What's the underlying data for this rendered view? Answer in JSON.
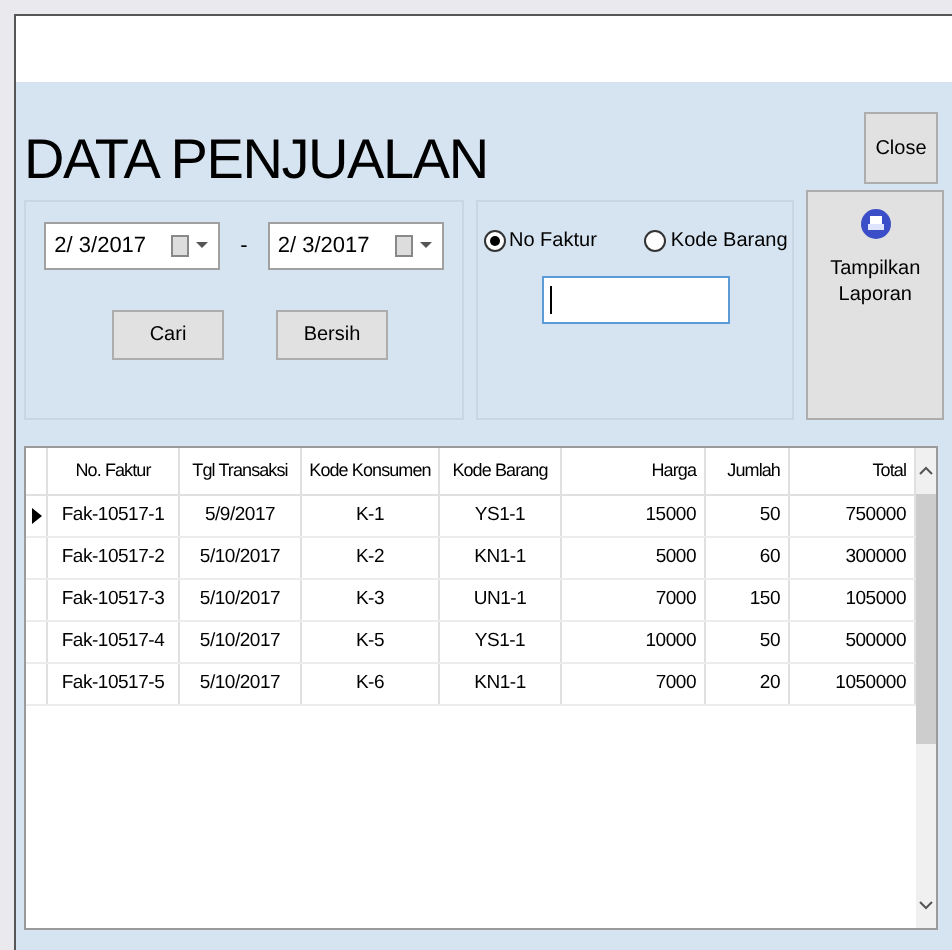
{
  "title": "DATA PENJUALAN",
  "close_button": "Close",
  "date_range": {
    "from": "2/ 3/2017",
    "separator": "-",
    "to": "2/ 3/2017"
  },
  "filter_buttons": [
    "Cari",
    "Bersih"
  ],
  "search_by": [
    {
      "label": "No Faktur",
      "selected": true
    },
    {
      "label": "Kode Barang",
      "selected": false
    }
  ],
  "report_button": {
    "line1": "Tampilkan",
    "line2": "Laporan"
  },
  "table": {
    "columns": [
      "No. Faktur",
      "Tgl Transaksi",
      "Kode Konsumen",
      "Kode Barang",
      "Harga",
      "Jumlah",
      "Total"
    ],
    "rows": [
      {
        "selected": true,
        "cells": [
          "Fak-10517-1",
          "5/9/2017",
          "K-1",
          "YS1-1",
          "15000",
          "50",
          "750000"
        ]
      },
      {
        "selected": false,
        "cells": [
          "Fak-10517-2",
          "5/10/2017",
          "K-2",
          "KN1-1",
          "5000",
          "60",
          "300000"
        ]
      },
      {
        "selected": false,
        "cells": [
          "Fak-10517-3",
          "5/10/2017",
          "K-3",
          "UN1-1",
          "7000",
          "150",
          "105000"
        ]
      },
      {
        "selected": false,
        "cells": [
          "Fak-10517-4",
          "5/10/2017",
          "K-5",
          "YS1-1",
          "10000",
          "50",
          "500000"
        ]
      },
      {
        "selected": false,
        "cells": [
          "Fak-10517-5",
          "5/10/2017",
          "K-6",
          "KN1-1",
          "7000",
          "20",
          "1050000"
        ]
      }
    ]
  }
}
